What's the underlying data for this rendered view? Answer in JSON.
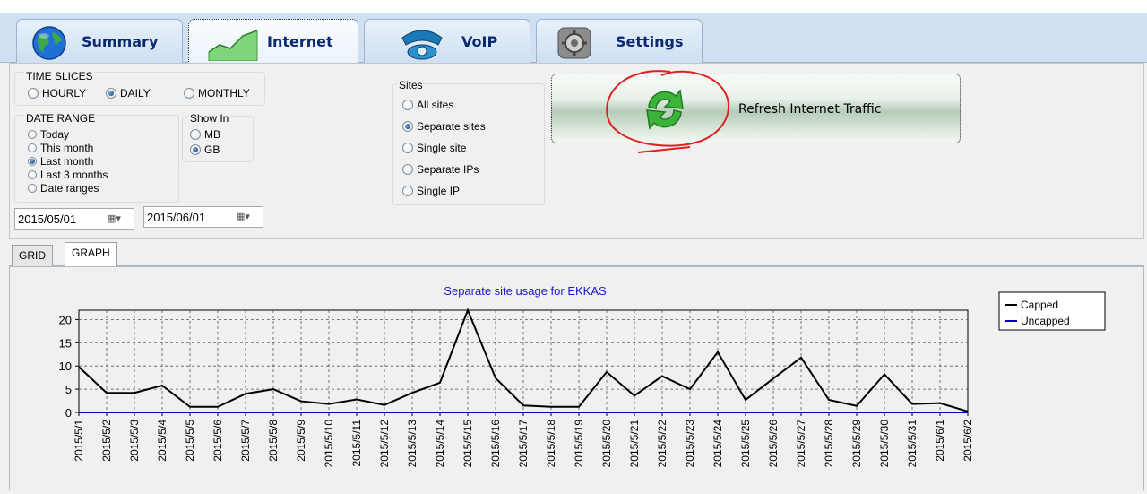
{
  "main_tabs": [
    {
      "label": "Summary",
      "icon": "globe-icon",
      "active": false
    },
    {
      "label": "Internet",
      "icon": "graph-icon",
      "active": true
    },
    {
      "label": "VoIP",
      "icon": "phone-icon",
      "active": false
    },
    {
      "label": "Settings",
      "icon": "gear-icon",
      "active": false
    }
  ],
  "time_slices": {
    "title": "TIME SLICES",
    "options": [
      "HOURLY",
      "DAILY",
      "MONTHLY"
    ],
    "selected": "DAILY"
  },
  "date_range": {
    "title": "DATE RANGE",
    "options": [
      "Today",
      "This month",
      "Last month",
      "Last 3 months",
      "Date ranges"
    ],
    "selected": "Last month"
  },
  "show_in": {
    "title": "Show In",
    "options": [
      "MB",
      "GB"
    ],
    "selected": "GB"
  },
  "sites": {
    "title": "Sites",
    "options": [
      "All sites",
      "Separate sites",
      "Single site",
      "Separate IPs",
      "Single IP"
    ],
    "selected": "Separate sites"
  },
  "date_from": "2015/05/01",
  "date_to": "2015/06/01",
  "refresh_button": {
    "label": "Refresh Internet Traffic",
    "icon": "refresh-icon"
  },
  "sub_tabs": [
    {
      "label": "GRID",
      "active": false
    },
    {
      "label": "GRAPH",
      "active": true
    }
  ],
  "colors": {
    "capped": "#000000",
    "uncapped": "#0000cc",
    "title": "#1a1acc",
    "annotation": "#e02020"
  },
  "chart_data": {
    "type": "line",
    "title": "Separate site usage for EKKAS",
    "xlabel": "",
    "ylabel": "",
    "ylim": [
      0,
      22
    ],
    "yticks": [
      0,
      5,
      10,
      15,
      20
    ],
    "grid": true,
    "legend_position": "top-right",
    "categories": [
      "2015/5/1",
      "2015/5/2",
      "2015/5/3",
      "2015/5/4",
      "2015/5/5",
      "2015/5/6",
      "2015/5/7",
      "2015/5/8",
      "2015/5/9",
      "2015/5/10",
      "2015/5/11",
      "2015/5/12",
      "2015/5/13",
      "2015/5/14",
      "2015/5/15",
      "2015/5/16",
      "2015/5/17",
      "2015/5/18",
      "2015/5/19",
      "2015/5/20",
      "2015/5/21",
      "2015/5/22",
      "2015/5/23",
      "2015/5/24",
      "2015/5/25",
      "2015/5/26",
      "2015/5/27",
      "2015/5/28",
      "2015/5/29",
      "2015/5/30",
      "2015/5/31",
      "2015/6/1",
      "2015/6/2"
    ],
    "series": [
      {
        "name": "Capped",
        "values": [
          9.8,
          4.2,
          4.2,
          5.8,
          1.2,
          1.2,
          4.0,
          5.0,
          2.4,
          1.8,
          2.8,
          1.6,
          4.2,
          6.4,
          22.0,
          7.4,
          1.5,
          1.2,
          1.2,
          8.7,
          3.6,
          7.8,
          5.0,
          13.0,
          2.7,
          7.3,
          11.8,
          2.7,
          1.4,
          8.2,
          1.8,
          2.0,
          0.2
        ]
      },
      {
        "name": "Uncapped",
        "values": [
          0,
          0,
          0,
          0,
          0,
          0,
          0,
          0,
          0,
          0,
          0,
          0,
          0,
          0,
          0,
          0,
          0,
          0,
          0,
          0,
          0,
          0,
          0,
          0,
          0,
          0,
          0,
          0,
          0,
          0,
          0,
          0,
          0
        ]
      }
    ]
  }
}
